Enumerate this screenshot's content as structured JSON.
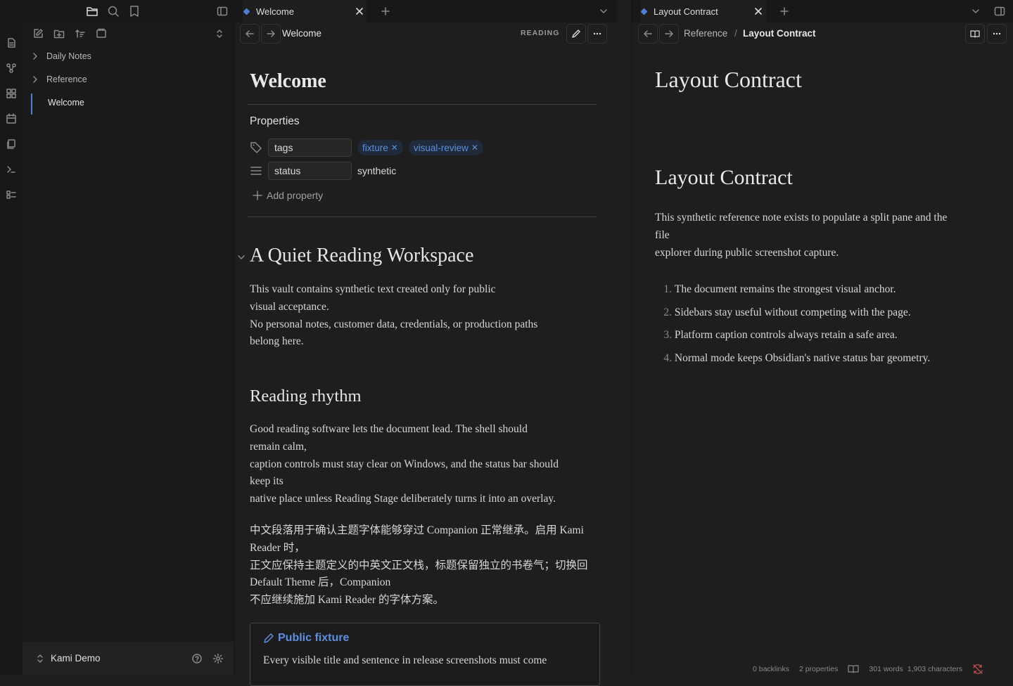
{
  "sidebar": {
    "tree": [
      {
        "label": "Daily Notes",
        "type": "folder"
      },
      {
        "label": "Reference",
        "type": "folder"
      },
      {
        "label": "Welcome",
        "type": "file"
      }
    ],
    "vault_name": "Kami Demo"
  },
  "pane_left": {
    "tab_label": "Welcome",
    "nav_title": "Welcome",
    "mode_label": "READING",
    "title": "Welcome",
    "properties": {
      "heading": "Properties",
      "rows": [
        {
          "key": "tags",
          "values": [
            "fixture",
            "visual-review"
          ]
        },
        {
          "key": "status",
          "value": "synthetic"
        }
      ],
      "add_label": "Add property"
    },
    "h1": "A Quiet Reading Workspace",
    "p1": [
      "This vault contains synthetic text created only for public",
      "visual acceptance.",
      "No personal notes, customer data, credentials, or production paths",
      "belong here."
    ],
    "h2": "Reading rhythm",
    "p2": [
      "Good reading software lets the document lead. The shell should",
      "remain calm,",
      "caption controls must stay clear on Windows, and the status bar should",
      "keep its",
      "native place unless Reading Stage deliberately turns it into an overlay."
    ],
    "p3": [
      "中文段落用于确认主题字体能够穿过 Companion 正常继承。启用 Kami",
      "Reader 时，",
      "正文应保持主题定义的中英文正文栈，标题保留独立的书卷气；切换回",
      "Default Theme 后，Companion",
      "不应继续施加 Kami Reader 的字体方案。"
    ],
    "callout": {
      "title": "Public fixture",
      "body": "Every visible title and sentence in release screenshots must come"
    }
  },
  "pane_right": {
    "tab_label": "Layout Contract",
    "breadcrumb_parent": "Reference",
    "breadcrumb_sep": "/",
    "breadcrumb_current": "Layout Contract",
    "title": "Layout Contract",
    "h1": "Layout Contract",
    "para": [
      "This synthetic reference note exists to populate a split pane and the",
      "file",
      "explorer during public screenshot capture."
    ],
    "list": [
      {
        "num": "1.",
        "text": "The document remains the strongest visual anchor."
      },
      {
        "num": "2.",
        "text": "Sidebars stay useful without competing with the page."
      },
      {
        "num": "3.",
        "text": "Platform caption controls always retain a safe area."
      },
      {
        "num": "4.",
        "text": "Normal mode keeps Obsidian's native status bar geometry."
      }
    ]
  },
  "statusbar": {
    "backlinks": "0 backlinks",
    "properties": "2 properties",
    "words": "301 words",
    "characters": "1,903 characters"
  },
  "colors": {
    "accent": "#4d7fd8",
    "tag": "#5d8fdc",
    "bg": "#1e1e1e"
  }
}
